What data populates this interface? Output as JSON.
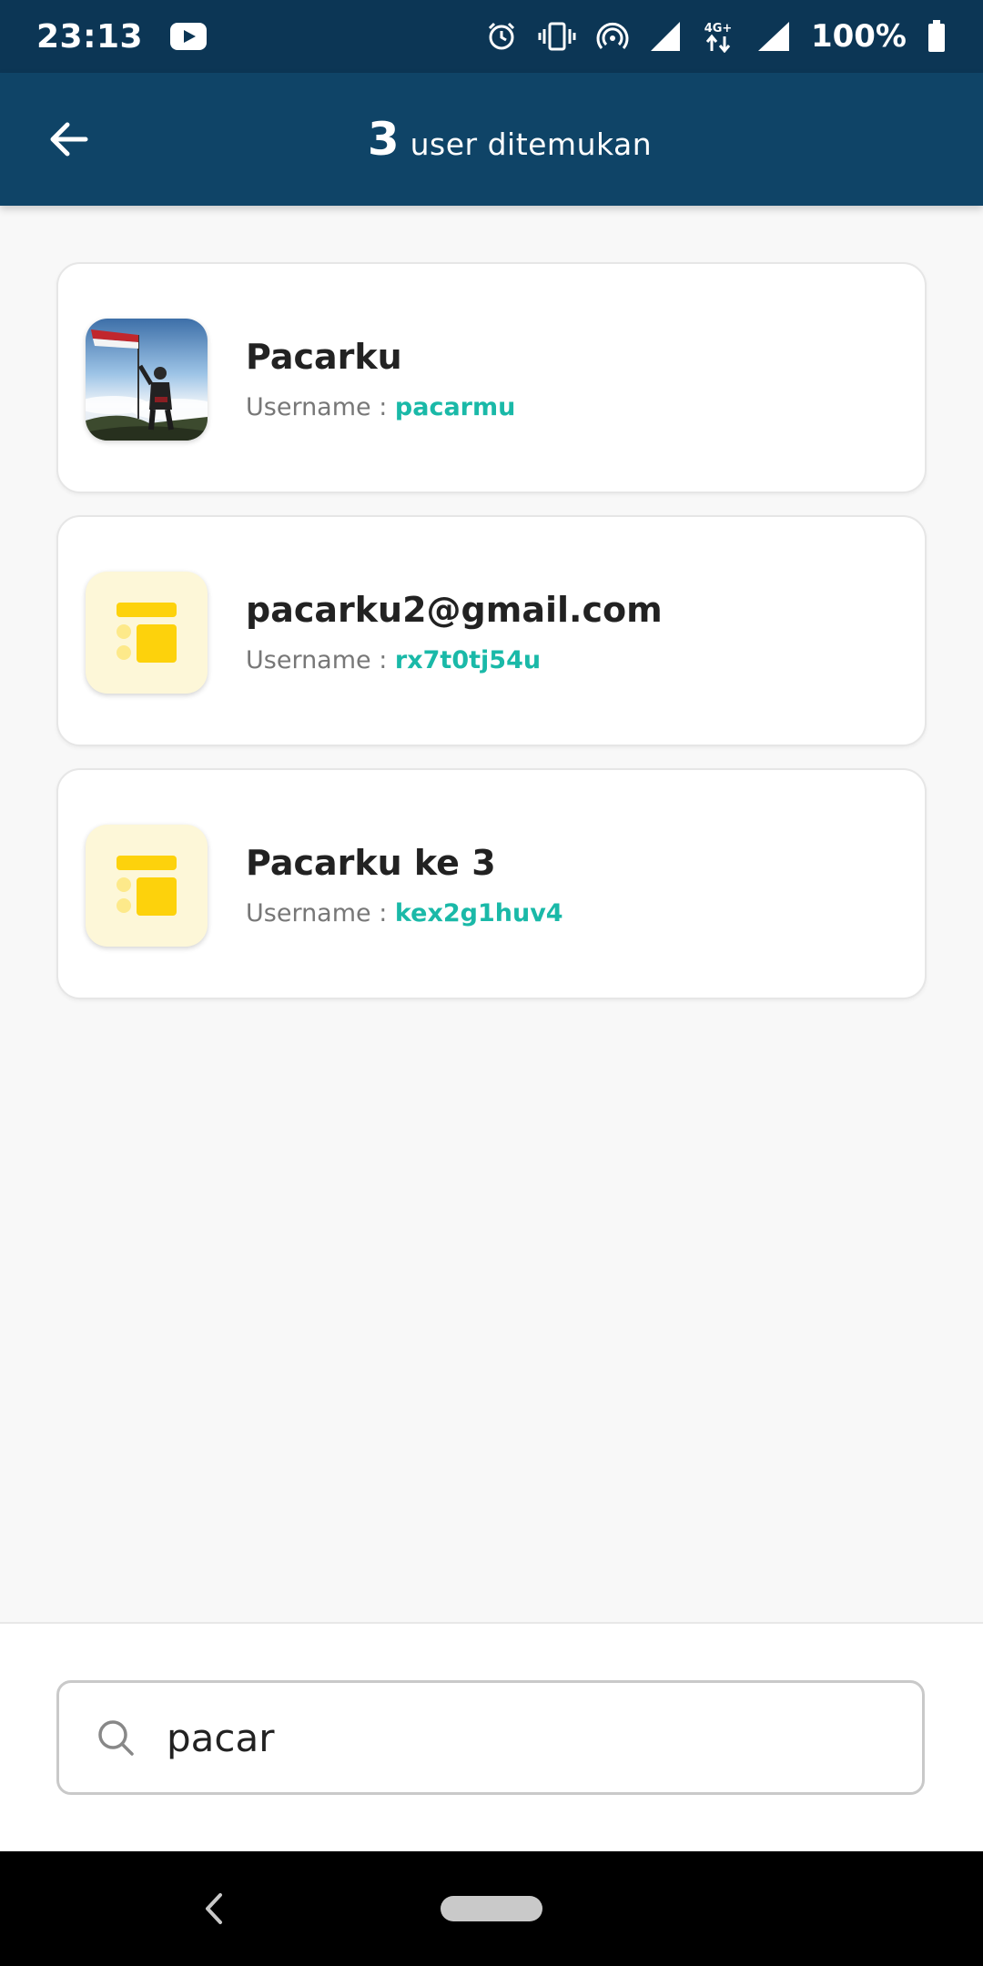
{
  "status_bar": {
    "time": "23:13",
    "battery": "100%",
    "network": "4G+",
    "icons": [
      "youtube-icon",
      "alarm-icon",
      "vibrate-icon",
      "hotspot-icon",
      "signal-icon",
      "data-4g-icon",
      "signal-icon",
      "battery-icon"
    ]
  },
  "app_bar": {
    "count": "3",
    "title": "user ditemukan",
    "back_icon": "arrow-left-icon"
  },
  "users": [
    {
      "name": "Pacarku",
      "username_label": "Username : ",
      "username": "pacarmu",
      "avatar": "photo"
    },
    {
      "name": "pacarku2@gmail.com",
      "username_label": "Username : ",
      "username": "rx7t0tj54u",
      "avatar": "default-layout-icon"
    },
    {
      "name": "Pacarku ke 3",
      "username_label": "Username : ",
      "username": "kex2g1huv4",
      "avatar": "default-layout-icon"
    }
  ],
  "search": {
    "value": "pacar",
    "icon": "search-icon"
  },
  "nav_bar": {
    "icons": [
      "nav-back-icon",
      "nav-home-pill"
    ]
  },
  "colors": {
    "status_bar": "#0c3655",
    "app_bar": "#0f4467",
    "username_accent": "#1ab9a8",
    "avatar_placeholder_bg": "#fdf7d8",
    "avatar_placeholder_fg": "#fdd20c"
  }
}
